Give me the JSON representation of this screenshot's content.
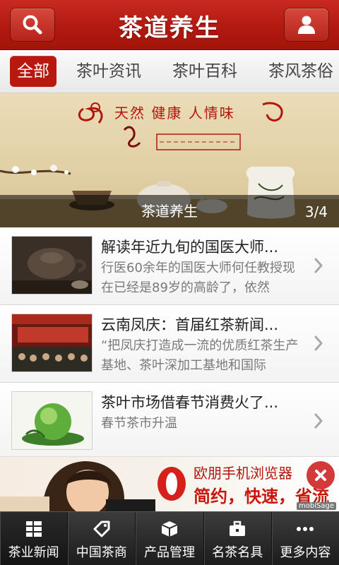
{
  "header": {
    "title": "茶道养生",
    "search_icon": "search-icon",
    "user_icon": "user-icon"
  },
  "tabs": [
    {
      "label": "全部",
      "active": true
    },
    {
      "label": "茶叶资讯",
      "active": false
    },
    {
      "label": "茶叶百科",
      "active": false
    },
    {
      "label": "茶风茶俗",
      "active": false
    }
  ],
  "banner": {
    "slogan": "天然 健康 人情味",
    "caption": "茶道养生",
    "counter": "3/4"
  },
  "news": [
    {
      "title": "解读年近九旬的国医大师...",
      "summary": "行医60余年的国医大师何任教授现在已经是89岁的高龄了，依然"
    },
    {
      "title": "云南凤庆：首届红茶新闻...",
      "summary": "“把凤庆打造成一流的优质红茶生产基地、茶叶深加工基地和国际"
    },
    {
      "title": "茶叶市场借春节消费火了...",
      "summary": "春节茶市升温"
    }
  ],
  "ad": {
    "title": "欧朋手机浏览器",
    "slogan": "简约，快速，省流量!",
    "mark": "mobiSage"
  },
  "bottom_nav": [
    {
      "label": "茶业新闻",
      "icon": "grid-icon"
    },
    {
      "label": "中国茶商",
      "icon": "tag-icon"
    },
    {
      "label": "产品管理",
      "icon": "box-icon"
    },
    {
      "label": "名茶名具",
      "icon": "briefcase-icon"
    },
    {
      "label": "更多内容",
      "icon": "more-icon"
    }
  ],
  "colors": {
    "brand_red": "#b8180e",
    "nav_dark": "#1c1c1c"
  }
}
